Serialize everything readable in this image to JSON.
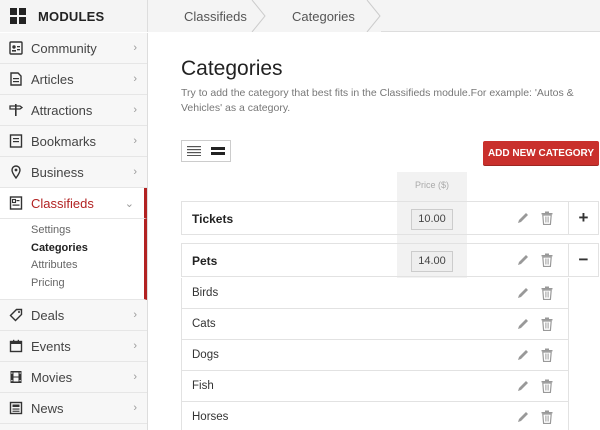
{
  "topbar": {
    "modules_label": "MODULES",
    "breadcrumb": [
      "Classifieds",
      "Categories"
    ]
  },
  "sidebar": {
    "items": [
      {
        "label": "Community",
        "icon": "users-icon"
      },
      {
        "label": "Articles",
        "icon": "document-icon"
      },
      {
        "label": "Attractions",
        "icon": "signpost-icon"
      },
      {
        "label": "Bookmarks",
        "icon": "book-icon"
      },
      {
        "label": "Business",
        "icon": "map-pin-icon"
      },
      {
        "label": "Classifieds",
        "icon": "classifieds-icon"
      },
      {
        "label": "Deals",
        "icon": "tag-icon"
      },
      {
        "label": "Events",
        "icon": "calendar-icon"
      },
      {
        "label": "Movies",
        "icon": "film-icon"
      },
      {
        "label": "News",
        "icon": "newspaper-icon"
      }
    ],
    "submenu": [
      "Settings",
      "Categories",
      "Attributes",
      "Pricing"
    ],
    "accent": "#b22222"
  },
  "main": {
    "title": "Categories",
    "description": "Try to add the category that best fits in the Classifieds module.For example: 'Autos & Vehicles' as a category.",
    "add_button": "ADD NEW CATEGORY",
    "price_header": "Price ($)",
    "categories": [
      {
        "name": "Tickets",
        "price": "10.00",
        "toggle": "+"
      },
      {
        "name": "Pets",
        "price": "14.00",
        "toggle": "−"
      }
    ],
    "subcategories": [
      "Birds",
      "Cats",
      "Dogs",
      "Fish",
      "Horses"
    ]
  }
}
